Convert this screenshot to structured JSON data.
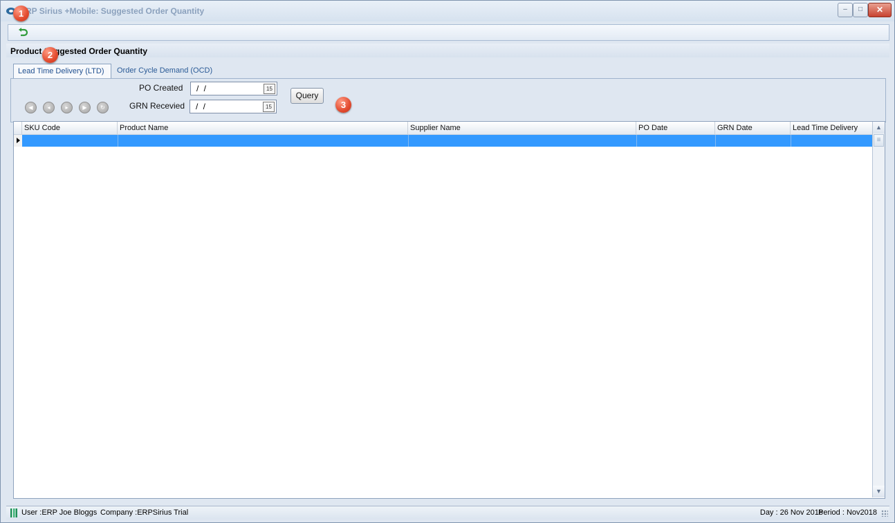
{
  "window": {
    "title": "ERP Sirius +Mobile: Suggested Order Quantity",
    "minimize": "–",
    "maximize": "□",
    "close": "✕"
  },
  "toolbar": {
    "refresh_icon": "refresh-icon"
  },
  "page": {
    "title": "Product Suggested Order Quantity"
  },
  "tabs": [
    {
      "label": "Lead Time Delivery (LTD)",
      "active": true
    },
    {
      "label": "Order Cycle Demand (OCD)",
      "active": false
    }
  ],
  "filters": {
    "po_created_label": "PO Created",
    "po_created_value": " / /",
    "grn_received_label": "GRN Recevied",
    "grn_received_value": " / /",
    "calendar_glyph": "15",
    "query_label": "Query"
  },
  "nav": [
    "first",
    "previous",
    "next",
    "last",
    "refresh"
  ],
  "grid": {
    "columns": [
      "SKU Code",
      "Product Name",
      "Supplier Name",
      "PO Date",
      "GRN Date",
      "Lead Time Delivery"
    ],
    "rows": [
      [
        "",
        "",
        "",
        "",
        "",
        ""
      ]
    ]
  },
  "status": {
    "user": "User :ERP Joe Bloggs",
    "company": "Company :ERPSirius Trial",
    "day": "Day : 26 Nov 2018",
    "period": "Period : Nov2018"
  },
  "callouts": [
    "1",
    "2",
    "3"
  ],
  "colors": {
    "selection": "#3399ff",
    "callout": "#e34b2f",
    "tab_text": "#2a5a96"
  }
}
